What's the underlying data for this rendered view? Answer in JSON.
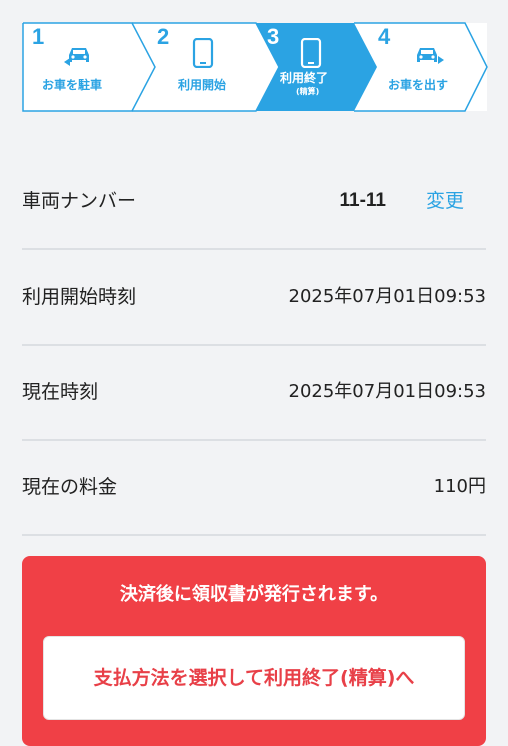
{
  "stepper": {
    "steps": [
      {
        "num": "1",
        "label": "お車を駐車",
        "icon": "car-park-icon"
      },
      {
        "num": "2",
        "label": "利用開始",
        "icon": "smartphone-icon"
      },
      {
        "num": "3",
        "label": "利用終了",
        "sub": "(精算)",
        "icon": "smartphone-icon",
        "active": true
      },
      {
        "num": "4",
        "label": "お車を出す",
        "icon": "car-exit-icon"
      }
    ],
    "colors": {
      "accent": "#2ba3e3",
      "active_bg": "#2ba3e3",
      "border": "#2ba3e3"
    }
  },
  "info": {
    "vehicle_label": "車両ナンバー",
    "vehicle_value": "11-11",
    "change_label": "変更",
    "start_label": "利用開始時刻",
    "start_value": "2025年07月01日09:53",
    "now_label": "現在時刻",
    "now_value": "2025年07月01日09:53",
    "fee_label": "現在の料金",
    "fee_value": "110円"
  },
  "payment": {
    "note": "決済後に領収書が発行されます。",
    "button_label": "支払方法を選択して利用終了(精算)へ",
    "panel_color": "#f04046"
  }
}
